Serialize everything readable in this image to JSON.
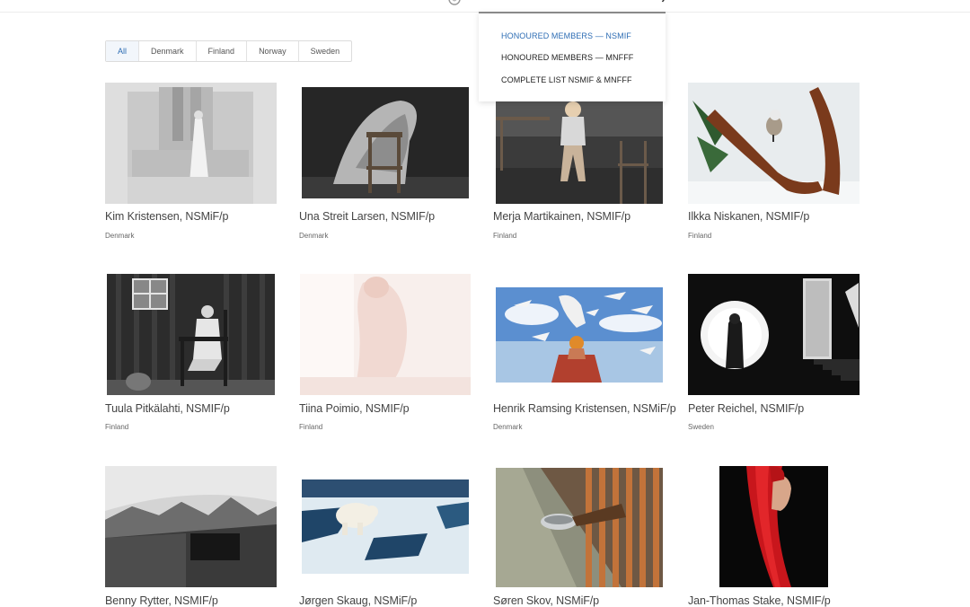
{
  "header": {
    "logo_icon": "club-emblem-icon",
    "search_icon": "search-icon"
  },
  "dropdown": {
    "items": [
      {
        "label": "HONOURED MEMBERS — NSMIF",
        "active": true
      },
      {
        "label": "HONOURED MEMBERS — MNFFF",
        "active": false
      },
      {
        "label": "COMPLETE LIST NSMIF & MNFFF",
        "active": false
      }
    ]
  },
  "filters": {
    "items": [
      {
        "label": "All",
        "active": true
      },
      {
        "label": "Denmark",
        "active": false
      },
      {
        "label": "Finland",
        "active": false
      },
      {
        "label": "Norway",
        "active": false
      },
      {
        "label": "Sweden",
        "active": false
      }
    ],
    "accent_color": "#2e6db4"
  },
  "members": [
    {
      "name": "Kim Kristensen, NSMiF/p",
      "country": "Denmark"
    },
    {
      "name": "Una Streit Larsen, NSMIF/p",
      "country": "Denmark"
    },
    {
      "name": "Merja Martikainen, NSMIF/p",
      "country": "Finland"
    },
    {
      "name": "Ilkka Niskanen, NSMIF/p",
      "country": "Finland"
    },
    {
      "name": "Tuula Pitkälahti, NSMIF/p",
      "country": "Finland"
    },
    {
      "name": "Tiina Poimio, NSMIF/p",
      "country": "Finland"
    },
    {
      "name": "Henrik Ramsing Kristensen, NSMiF/p",
      "country": "Denmark"
    },
    {
      "name": "Peter Reichel, NSMIF/p",
      "country": "Sweden"
    },
    {
      "name": "Benny Rytter, NSMIF/p",
      "country": ""
    },
    {
      "name": "Jørgen Skaug, NSMiF/p",
      "country": ""
    },
    {
      "name": "Søren Skov, NSMiF/p",
      "country": ""
    },
    {
      "name": "Jan-Thomas Stake, NSMIF/p",
      "country": ""
    }
  ]
}
